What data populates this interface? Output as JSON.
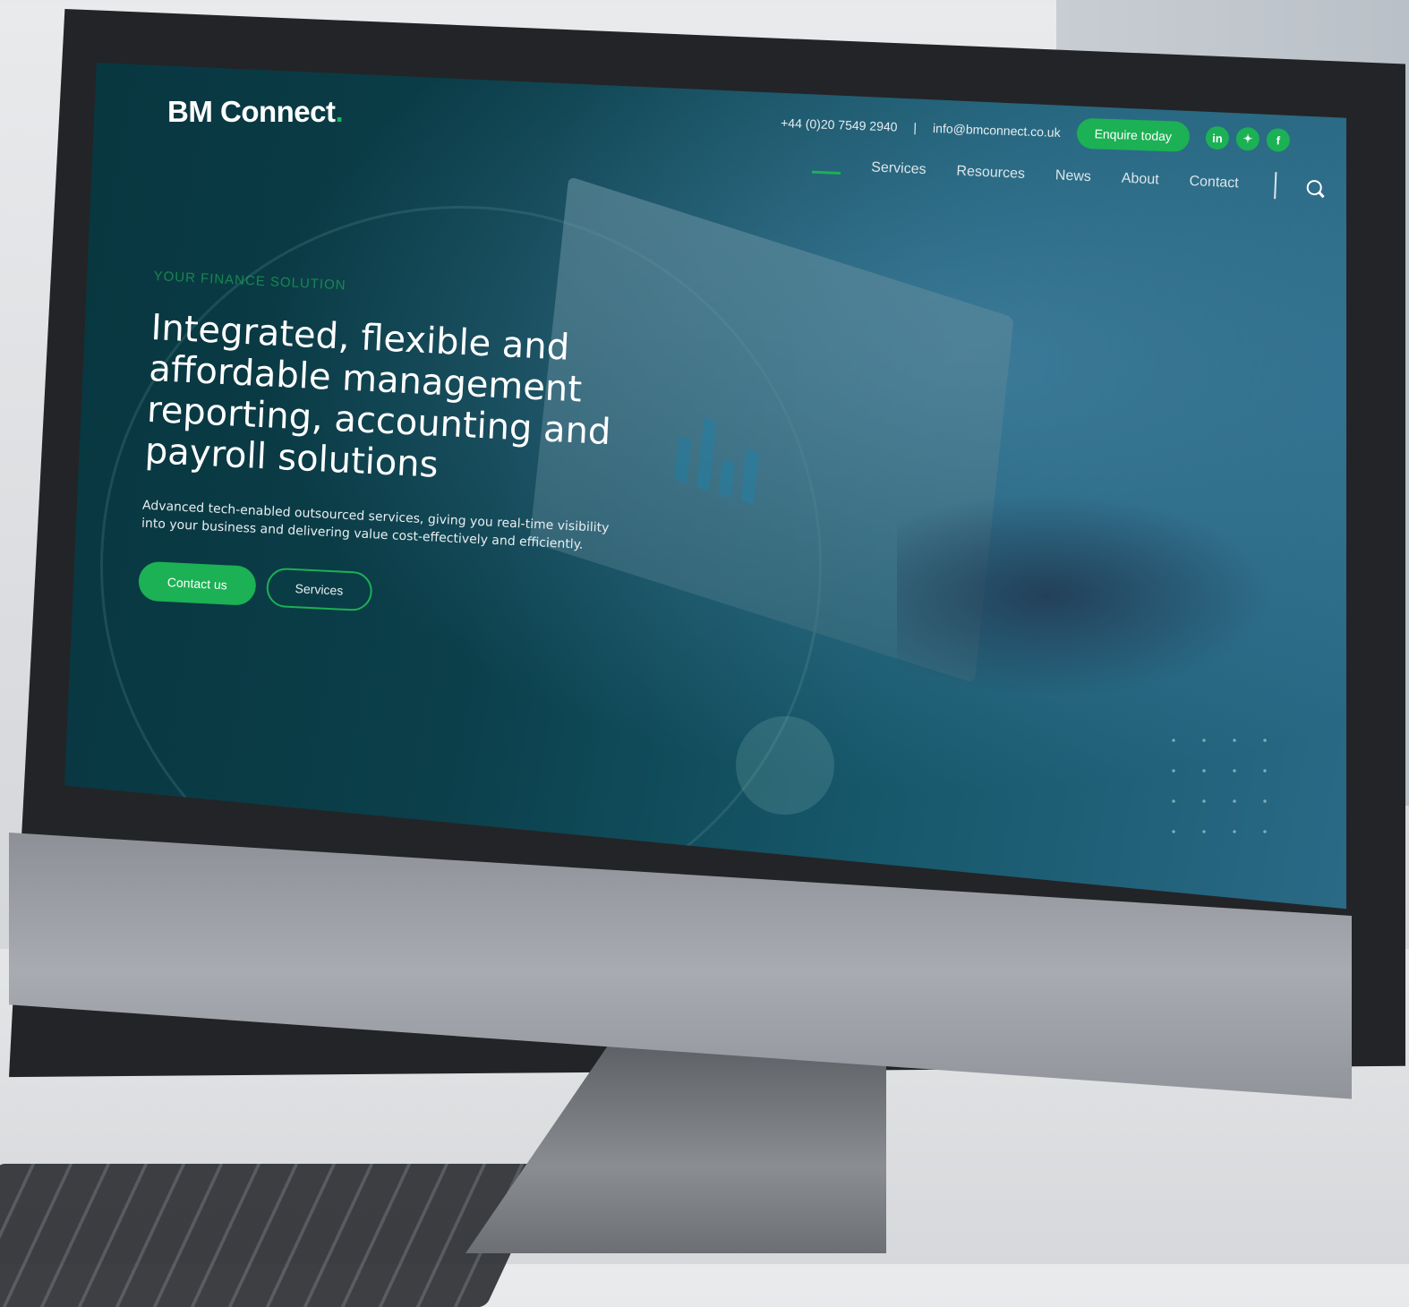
{
  "site": {
    "logo": "BM Connect",
    "logo_dot": ".",
    "phone": "+44 (0)20 7549 2940",
    "divider": "|",
    "email": "info@bmconnect.co.uk",
    "enquire_label": "Enquire today",
    "social": [
      "in",
      "✦",
      "f"
    ]
  },
  "nav": {
    "items": [
      "Services",
      "Resources",
      "News",
      "About",
      "Contact"
    ]
  },
  "hero": {
    "eyebrow": "YOUR FINANCE SOLUTION",
    "headline": "Integrated, flexible and affordable management reporting, accounting and payroll solutions",
    "sub": "Advanced tech-enabled outsourced services, giving you real-time visibility into your business and delivering value cost-effectively and efficiently.",
    "primary_btn": "Contact us",
    "secondary_btn": "Services"
  },
  "colors": {
    "accent": "#1bb154",
    "screen_bg": "#0b3f4a"
  }
}
